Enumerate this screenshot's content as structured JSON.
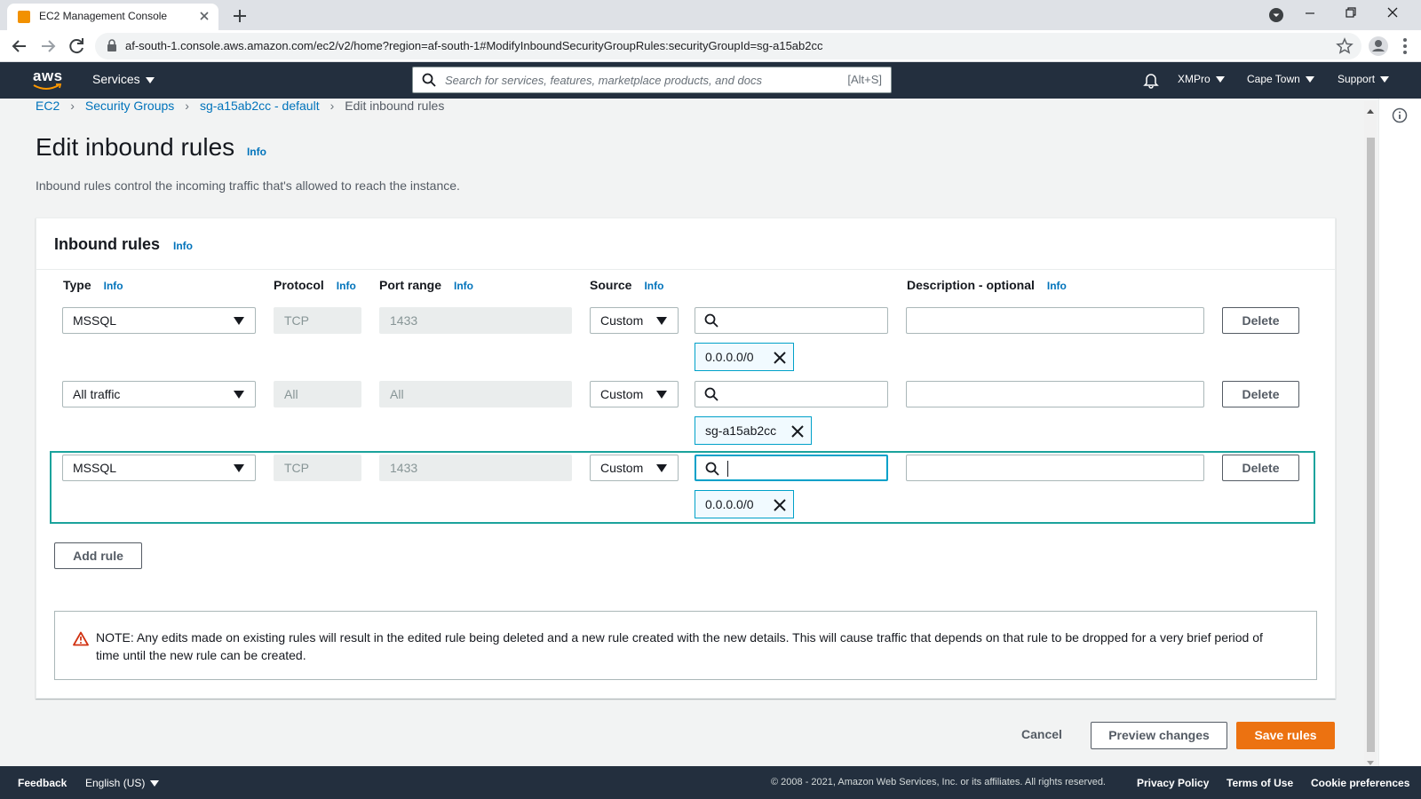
{
  "browser": {
    "tab_title": "EC2 Management Console",
    "url": "af-south-1.console.aws.amazon.com/ec2/v2/home?region=af-south-1#ModifyInboundSecurityGroupRules:securityGroupId=sg-a15ab2cc"
  },
  "aws_nav": {
    "logo_text": "aws",
    "services_label": "Services",
    "search_placeholder": "Search for services, features, marketplace products, and docs",
    "search_shortcut": "[Alt+S]",
    "account": "XMPro",
    "region": "Cape Town",
    "support": "Support"
  },
  "breadcrumb": [
    "EC2",
    "Security Groups",
    "sg-a15ab2cc - default",
    "Edit inbound rules"
  ],
  "page": {
    "title": "Edit inbound rules",
    "title_info": "Info",
    "description": "Inbound rules control the incoming traffic that's allowed to reach the instance."
  },
  "panel": {
    "title": "Inbound rules",
    "title_info": "Info",
    "columns": {
      "type": "Type",
      "protocol": "Protocol",
      "port_range": "Port range",
      "source": "Source",
      "description": "Description - optional",
      "info": "Info"
    },
    "rules": [
      {
        "type": "MSSQL",
        "protocol": "TCP",
        "port_range": "1433",
        "source": "Custom",
        "search_value": "",
        "token": "0.0.0.0/0",
        "description": "",
        "delete": "Delete"
      },
      {
        "type": "All traffic",
        "protocol": "All",
        "port_range": "All",
        "source": "Custom",
        "search_value": "",
        "token": "sg-a15ab2cc",
        "description": "",
        "delete": "Delete"
      },
      {
        "type": "MSSQL",
        "protocol": "TCP",
        "port_range": "1433",
        "source": "Custom",
        "search_value": "",
        "token": "0.0.0.0/0",
        "description": "",
        "delete": "Delete"
      }
    ],
    "add_rule": "Add rule",
    "notice": "NOTE: Any edits made on existing rules will result in the edited rule being deleted and a new rule created with the new details. This will cause traffic that depends on that rule to be dropped for a very brief period of time until the new rule can be created."
  },
  "actions": {
    "cancel": "Cancel",
    "preview": "Preview changes",
    "save": "Save rules"
  },
  "footer": {
    "feedback": "Feedback",
    "language": "English (US)",
    "copyright": "© 2008 - 2021, Amazon Web Services, Inc. or its affiliates. All rights reserved.",
    "privacy": "Privacy Policy",
    "terms": "Terms of Use",
    "cookies": "Cookie preferences"
  },
  "colors": {
    "aws_nav_bg": "#232f3e",
    "link": "#0073bb",
    "primary": "#ec7211",
    "focus": "#00a1c9",
    "row_highlight": "#1ba39c"
  }
}
